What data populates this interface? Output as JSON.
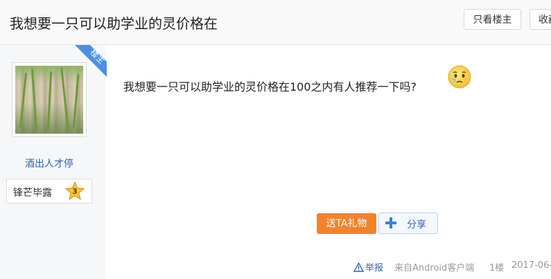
{
  "header": {
    "title": "我想要一只可以助学业的灵价格在",
    "only_op_label": "只看楼主",
    "collect_label": "收藏"
  },
  "author": {
    "op_ribbon_label": "楼主",
    "username": "酒出人才停",
    "badge_label": "锋芒毕露",
    "level": "3"
  },
  "post": {
    "text": "我想要一只可以助学业的灵价格在100之内有人推荐一下吗?",
    "emoji": "crying-face-icon"
  },
  "actions": {
    "gift_label": "送TA礼物",
    "share_label": "分享"
  },
  "meta": {
    "report_label": "举报",
    "source": "来自Android客户端",
    "floor": "1楼",
    "date": "2017-06-"
  },
  "colors": {
    "accent_blue": "#2d64b3",
    "gift_orange": "#f3822b",
    "op_ribbon": "#4c8fe8"
  }
}
